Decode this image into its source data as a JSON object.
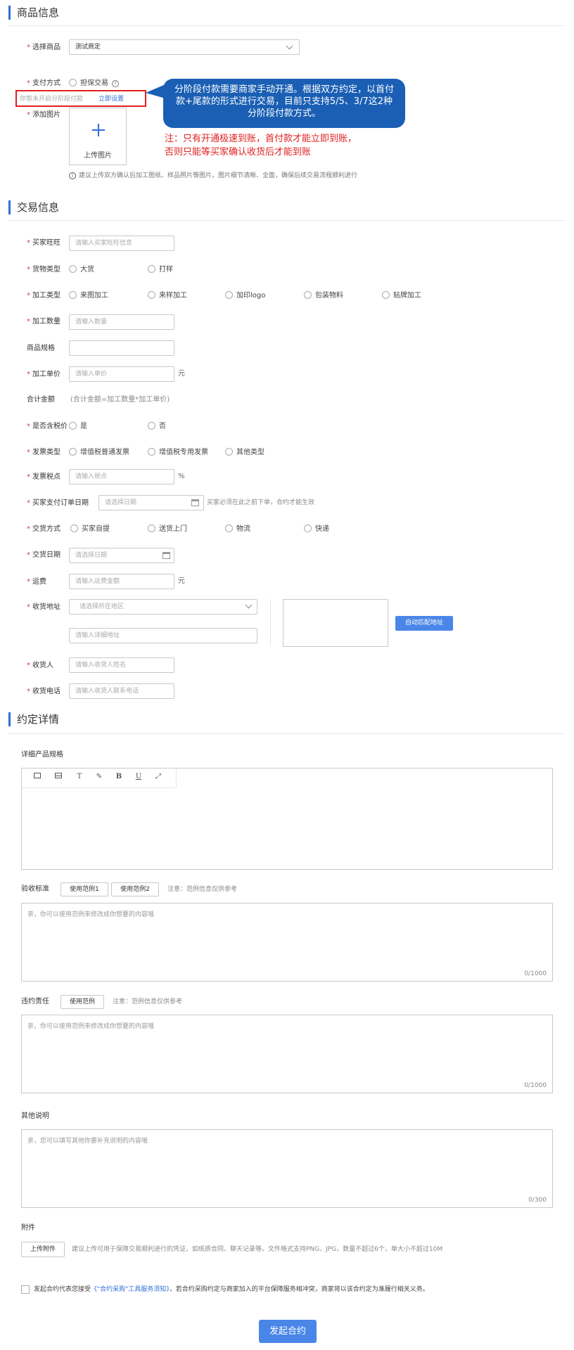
{
  "sections": {
    "product": "商品信息",
    "trade": "交易信息",
    "agreement": "约定详情"
  },
  "product": {
    "select_label": "选择商品",
    "select_value": "测试商定",
    "pay_label": "支付方式",
    "pay_option": "担保交易",
    "pay_help_icon": "help-circle-icon",
    "stage_notice": "你暂未开启分阶段付款",
    "stage_link": "立即设置",
    "image_label": "添加图片",
    "upload_icon": "plus-icon",
    "upload_text": "上传图片",
    "image_tip": "建议上传双方确认后加工图纸、样品照片等图片，图片细节清晰、全面，确保后续交易流程顺利进行",
    "callout_text": "分阶段付款需要商家手动开通。根据双方约定，以首付款+尾款的形式进行交易，目前只支持5/5、3/7这2种分阶段付款方式。",
    "note_line1": "注：只有开通极速到账，首付款才能立即到账，",
    "note_line2": "否则只能等买家确认收货后才能到账"
  },
  "trade": {
    "buyer_label": "买家旺旺",
    "buyer_placeholder": "请输入买家旺旺信息",
    "goods_type_label": "货物类型",
    "goods_type_options": [
      "大货",
      "打样"
    ],
    "process_type_label": "加工类型",
    "process_type_options": [
      "来图加工",
      "来样加工",
      "加印logo",
      "包装物料",
      "贴牌加工"
    ],
    "qty_label": "加工数量",
    "qty_placeholder": "请输入数量",
    "spec_label": "商品规格",
    "price_label": "加工单价",
    "price_placeholder": "请输入单价",
    "price_unit": "元",
    "total_label": "合计金额",
    "total_hint": "(合计金额=加工数量*加工单价)",
    "tax_label": "是否含税价",
    "tax_options": [
      "是",
      "否"
    ],
    "invoice_label": "发票类型",
    "invoice_options": [
      "增值税普通发票",
      "增值税专用发票",
      "其他类型"
    ],
    "tax_rate_label": "发票税点",
    "tax_rate_placeholder": "请输入税点",
    "tax_rate_unit": "%",
    "pay_date_label": "买家支付订单日期",
    "pay_date_placeholder": "请选择日期",
    "pay_date_hint": "买家必须在此之前下单，合约才能生效",
    "delivery_label": "交货方式",
    "delivery_options": [
      "买家自提",
      "送货上门",
      "物流",
      "快递"
    ],
    "delivery_date_label": "交货日期",
    "delivery_date_placeholder": "请选择日期",
    "freight_label": "运费",
    "freight_placeholder": "请输入运费金额",
    "freight_unit": "元",
    "address_label": "收货地址",
    "region_placeholder": "请选择所在地区",
    "detail_addr_placeholder": "请输入详细地址",
    "auto_match_btn": "自动匹配地址",
    "receiver_label": "收货人",
    "receiver_placeholder": "请输入收货人姓名",
    "phone_label": "收货电话",
    "phone_placeholder": "请输入收货人联系电话"
  },
  "agreement": {
    "spec_label": "详细产品规格",
    "toolbar": [
      "image-icon",
      "table-icon",
      "font-size-icon",
      "pen-icon",
      "bold-icon",
      "underline-icon",
      "fullscreen-icon"
    ],
    "toolbar_glyphs": [
      "T",
      "B",
      "U"
    ],
    "acceptance_label": "验收标准",
    "acceptance_btn1": "使用范例1",
    "acceptance_btn2": "使用范例2",
    "acceptance_note": "注意：范例信息仅供参考",
    "acceptance_placeholder": "亲，你可以使用范例来修改成你想要的内容哦",
    "acceptance_count": "0/1000",
    "breach_label": "违约责任",
    "breach_btn": "使用范例",
    "breach_note": "注意：范例信息仅供参考",
    "breach_placeholder": "亲，你可以使用范例来修改成你想要的内容哦",
    "breach_count": "0/1000",
    "other_label": "其他说明",
    "other_placeholder": "亲，您可以填写其他你要补充说明的内容哦",
    "other_count": "0/300",
    "attach_label": "附件",
    "attach_btn": "上传附件",
    "attach_hint": "建议上传可用于保障交易顺利进行的凭证，如纸质合同、聊天记录等。文件格式支持PNG、JPG，数量不超过6个，单大小不超过10M",
    "agree_prefix": "发起合约代表您接受",
    "agree_link": "《\"合约采购\"工具服务须知》",
    "agree_suffix": "，若合约采购约定与商家加入的平台保障服务相冲突，商家将以该合约定为准履行相关义务。",
    "submit_btn": "发起合约"
  },
  "colors": {
    "accent": "#2f6fd6",
    "callout": "#1a5fb4",
    "required": "#e4393c",
    "note": "#e02020"
  }
}
